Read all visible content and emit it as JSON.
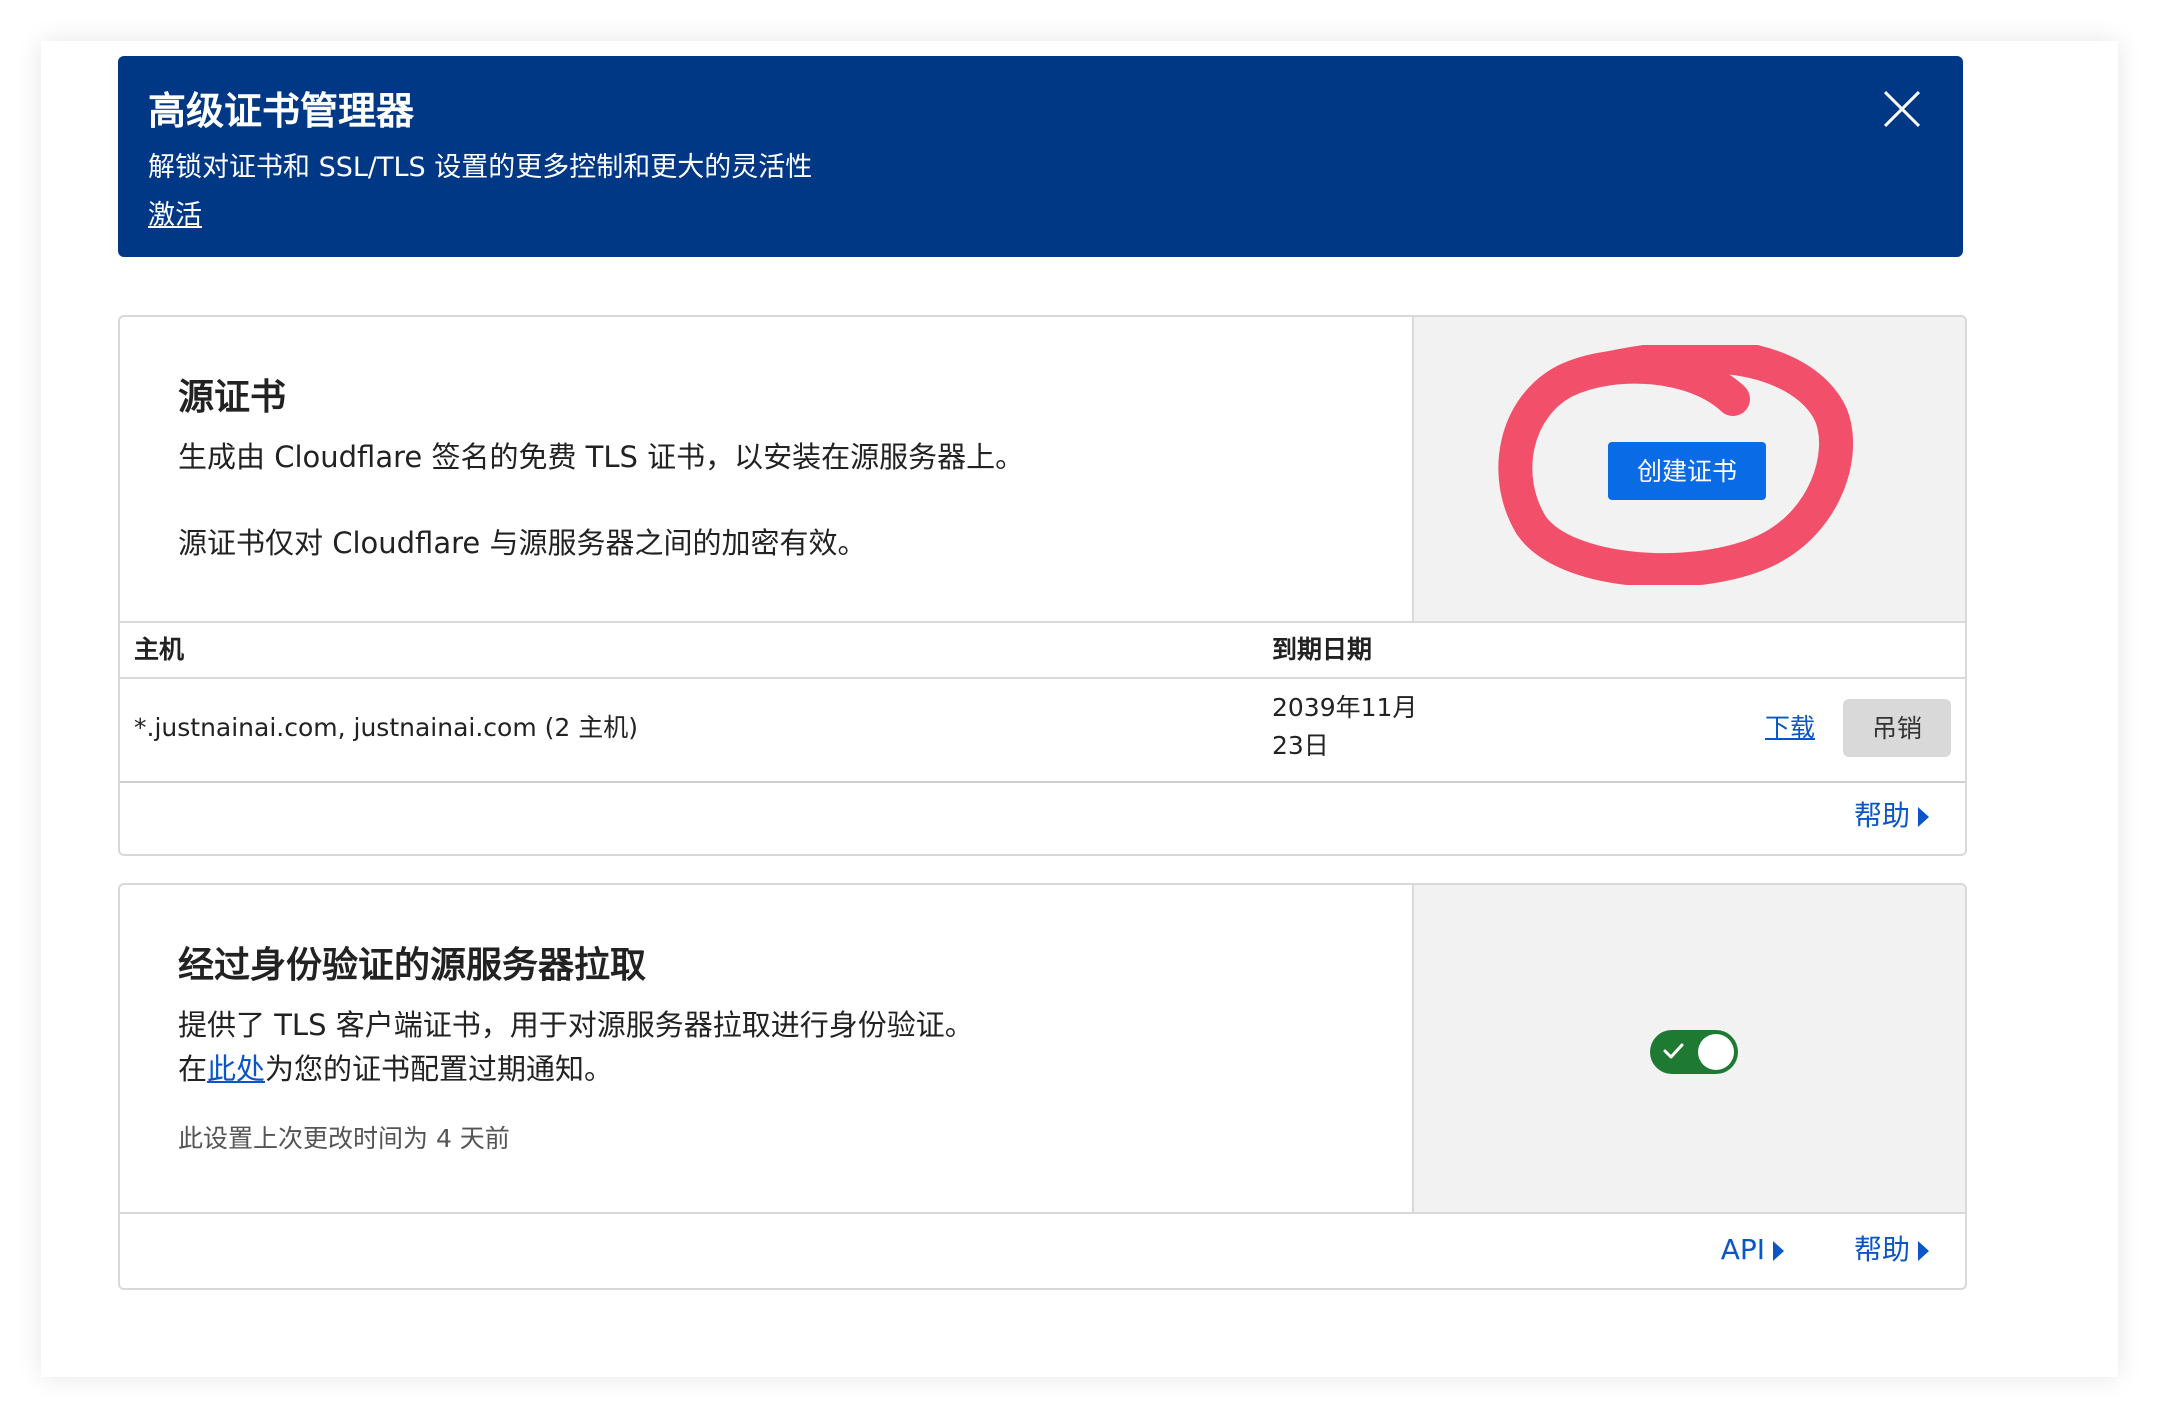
{
  "banner": {
    "title": "高级证书管理器",
    "subtitle": "解锁对证书和 SSL/TLS 设置的更多控制和更大的灵活性",
    "link": "激活"
  },
  "origin_cert": {
    "title": "源证书",
    "desc1": "生成由 Cloudflare 签名的免费 TLS 证书，以安装在源服务器上。",
    "desc2": "源证书仅对 Cloudflare 与源服务器之间的加密有效。",
    "create_button": "创建证书",
    "table": {
      "headers": [
        "主机",
        "到期日期"
      ],
      "rows": [
        {
          "host": "*.justnainai.com, justnainai.com (2 主机)",
          "expiry_line1": "2039年11月",
          "expiry_line2": "23日",
          "download": "下载",
          "revoke": "吊销"
        }
      ]
    },
    "help": "帮助"
  },
  "auth_pull": {
    "title": "经过身份验证的源服务器拉取",
    "desc1": "提供了 TLS 客户端证书，用于对源服务器拉取进行身份验证。",
    "desc2_prefix": "在",
    "desc2_link": "此处",
    "desc2_suffix": "为您的证书配置过期通知。",
    "last_changed": "此设置上次更改时间为 4 天前",
    "toggle_on": true,
    "api": "API",
    "help": "帮助"
  },
  "colors": {
    "banner_bg": "#013885",
    "primary": "#0a6be6",
    "link": "#0a56c8",
    "toggle_on": "#1e7a33",
    "annotation": "#f2506a"
  }
}
